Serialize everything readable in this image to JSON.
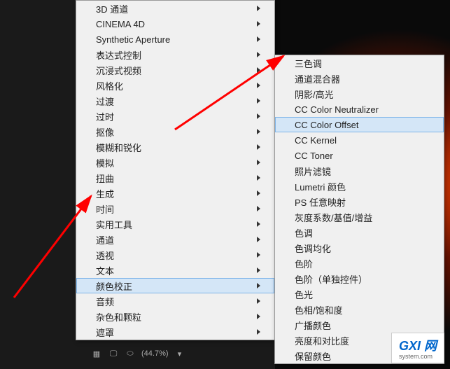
{
  "main_menu": {
    "items": [
      {
        "label": "3D 通道",
        "has_sub": true
      },
      {
        "label": "CINEMA 4D",
        "has_sub": true
      },
      {
        "label": "Synthetic Aperture",
        "has_sub": true
      },
      {
        "label": "表达式控制",
        "has_sub": true
      },
      {
        "label": "沉浸式视频",
        "has_sub": true
      },
      {
        "label": "风格化",
        "has_sub": true
      },
      {
        "label": "过渡",
        "has_sub": true
      },
      {
        "label": "过时",
        "has_sub": true
      },
      {
        "label": "抠像",
        "has_sub": true
      },
      {
        "label": "模糊和锐化",
        "has_sub": true
      },
      {
        "label": "模拟",
        "has_sub": true
      },
      {
        "label": "扭曲",
        "has_sub": true
      },
      {
        "label": "生成",
        "has_sub": true
      },
      {
        "label": "时间",
        "has_sub": true
      },
      {
        "label": "实用工具",
        "has_sub": true
      },
      {
        "label": "通道",
        "has_sub": true
      },
      {
        "label": "透视",
        "has_sub": true
      },
      {
        "label": "文本",
        "has_sub": true
      },
      {
        "label": "颜色校正",
        "has_sub": true,
        "highlighted": true
      },
      {
        "label": "音频",
        "has_sub": true
      },
      {
        "label": "杂色和颗粒",
        "has_sub": true
      },
      {
        "label": "遮罩",
        "has_sub": true
      }
    ]
  },
  "sub_menu": {
    "items": [
      {
        "label": "三色调"
      },
      {
        "label": "通道混合器"
      },
      {
        "label": "阴影/高光"
      },
      {
        "label": "CC Color Neutralizer"
      },
      {
        "label": "CC Color Offset",
        "highlighted": true
      },
      {
        "label": "CC Kernel"
      },
      {
        "label": "CC Toner"
      },
      {
        "label": "照片滤镜"
      },
      {
        "label": "Lumetri 颜色"
      },
      {
        "label": "PS 任意映射"
      },
      {
        "label": "灰度系数/基值/增益"
      },
      {
        "label": "色调"
      },
      {
        "label": "色调均化"
      },
      {
        "label": "色阶"
      },
      {
        "label": "色阶（单独控件）"
      },
      {
        "label": "色光"
      },
      {
        "label": "色相/饱和度"
      },
      {
        "label": "广播颜色"
      },
      {
        "label": "亮度和对比度"
      },
      {
        "label": "保留颜色"
      }
    ]
  },
  "status_bar": {
    "zoom": "(44.7%)"
  },
  "watermark": {
    "text": "GXI 网",
    "sub": "system.com"
  }
}
